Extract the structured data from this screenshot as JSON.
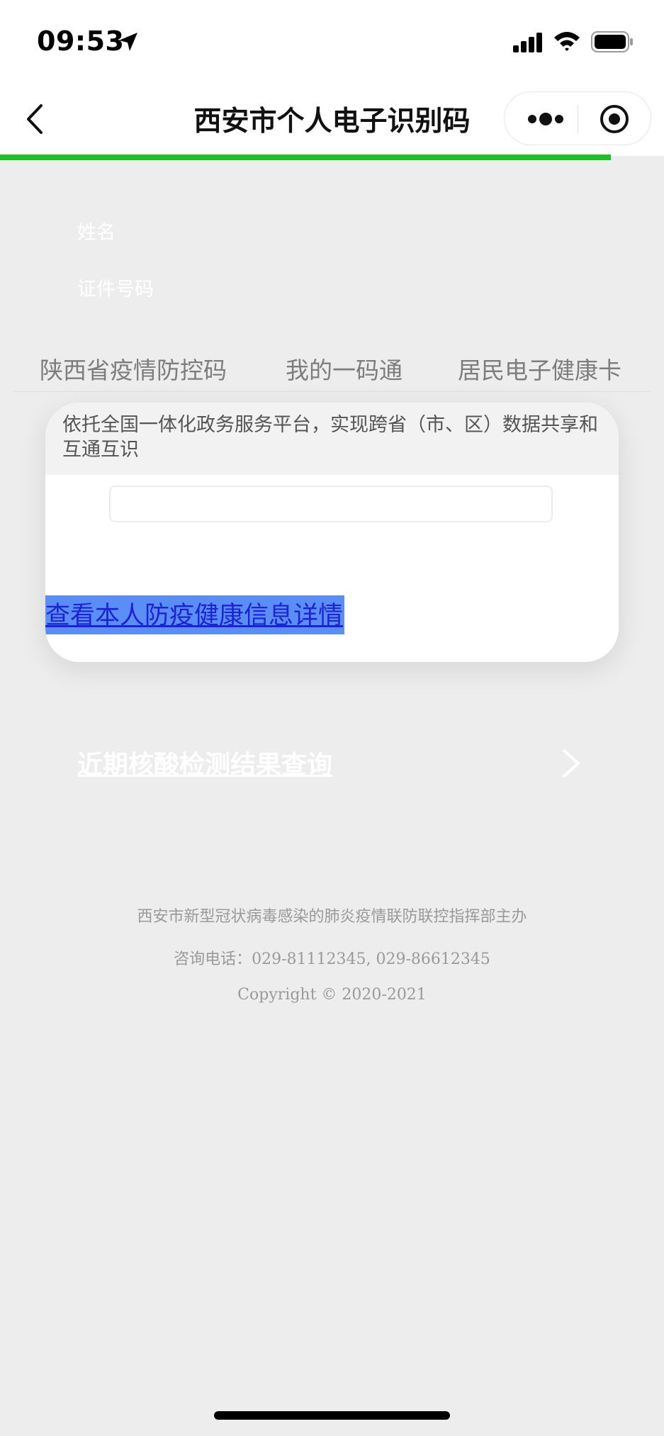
{
  "status_bar": {
    "time": "09:53"
  },
  "nav": {
    "title": "西安市个人电子识别码"
  },
  "info": {
    "name_label": "姓名",
    "id_label": "证件号码"
  },
  "tabs": [
    {
      "label": "陕西省疫情防控码"
    },
    {
      "label": "我的一码通"
    },
    {
      "label": "居民电子健康卡"
    }
  ],
  "card": {
    "header_text": "依托全国一体化政务服务平台，实现跨省（市、区）数据共享和互通互识",
    "input_value": "",
    "detail_link": "查看本人防疫健康信息详情"
  },
  "nucleic_link": "近期核酸检测结果查询",
  "footer": {
    "organizer": "西安市新型冠状病毒感染的肺炎疫情联防联控指挥部主办",
    "phone": "咨询电话：029-81112345, 029-86612345",
    "copyright": "Copyright © 2020-2021"
  },
  "colors": {
    "progress": "#1ec220",
    "page_bg": "#ededed",
    "link_highlight": "#5b8ef5"
  }
}
